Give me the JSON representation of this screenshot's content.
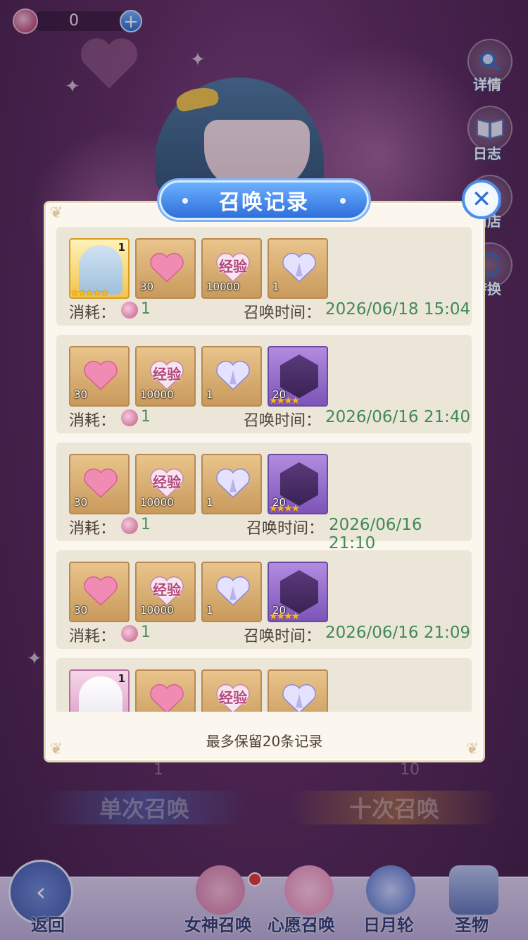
{
  "currency": {
    "amount": "0",
    "plus": "+"
  },
  "side_menu": [
    {
      "label": "详情",
      "icon": "magnifier-icon"
    },
    {
      "label": "日志",
      "icon": "book-icon"
    },
    {
      "label": "商店",
      "icon": "shop-icon"
    },
    {
      "label": "转换",
      "icon": "swap-icon"
    }
  ],
  "summon": {
    "single_label": "单次召唤",
    "ten_label": "十次召唤",
    "single_cost": "1",
    "ten_cost": "10"
  },
  "nav": {
    "back": "返回",
    "goddess": "女神召唤",
    "wish": "心愿召唤",
    "sunmoon": "日月轮",
    "relic": "圣物"
  },
  "dialog": {
    "title": "召唤记录",
    "close": "✕",
    "footer": "最多保留20条记录",
    "consume_label": "消耗：",
    "time_label": "召唤时间：",
    "records": [
      {
        "items": [
          {
            "kind": "character",
            "qty": "1",
            "stars": "★★★★★"
          },
          {
            "kind": "pink-heart",
            "qty": "30"
          },
          {
            "kind": "exp-heart",
            "qty": "10000",
            "tag": "经验"
          },
          {
            "kind": "crystal-heart",
            "qty": "1"
          }
        ],
        "cost": "1",
        "time": "2026/06/18 15:04"
      },
      {
        "items": [
          {
            "kind": "pink-heart",
            "qty": "30"
          },
          {
            "kind": "exp-heart",
            "qty": "10000",
            "tag": "经验"
          },
          {
            "kind": "crystal-heart",
            "qty": "1"
          },
          {
            "kind": "shard",
            "qty": "20",
            "stars": "★★★★"
          }
        ],
        "cost": "1",
        "time": "2026/06/16 21:40"
      },
      {
        "items": [
          {
            "kind": "pink-heart",
            "qty": "30"
          },
          {
            "kind": "exp-heart",
            "qty": "10000",
            "tag": "经验"
          },
          {
            "kind": "crystal-heart",
            "qty": "1"
          },
          {
            "kind": "shard",
            "qty": "20",
            "stars": "★★★★"
          }
        ],
        "cost": "1",
        "time": "2026/06/16 21:10"
      },
      {
        "items": [
          {
            "kind": "pink-heart",
            "qty": "30"
          },
          {
            "kind": "exp-heart",
            "qty": "10000",
            "tag": "经验"
          },
          {
            "kind": "crystal-heart",
            "qty": "1"
          },
          {
            "kind": "shard",
            "qty": "20",
            "stars": "★★★★"
          }
        ],
        "cost": "1",
        "time": "2026/06/16 21:09"
      },
      {
        "items": [
          {
            "kind": "character2",
            "qty": "1"
          },
          {
            "kind": "pink-heart",
            "qty": ""
          },
          {
            "kind": "exp-heart",
            "qty": "",
            "tag": "经验"
          },
          {
            "kind": "crystal-heart",
            "qty": ""
          }
        ],
        "cost": "",
        "time": ""
      }
    ]
  },
  "colors": {
    "accent_blue": "#2e6fdc",
    "time_green": "#3f8a55",
    "dialog_bg": "#fbf7ee"
  }
}
